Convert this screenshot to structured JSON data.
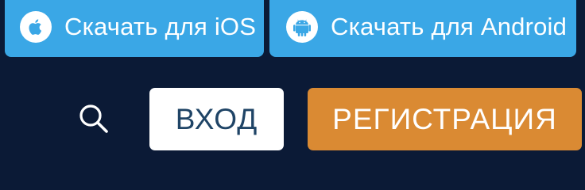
{
  "app_links": {
    "ios": {
      "label": "Скачать для iOS",
      "icon": "apple-icon"
    },
    "android": {
      "label": "Скачать для Android",
      "icon": "android-icon"
    }
  },
  "header": {
    "search_icon": "search-icon",
    "login_label": "ВХОД",
    "register_label": "РЕГИСТРАЦИЯ"
  },
  "colors": {
    "background": "#0b1a36",
    "app_button": "#3aa7e6",
    "login_bg": "#ffffff",
    "login_text": "#1f4466",
    "register_bg": "#da8a33"
  }
}
